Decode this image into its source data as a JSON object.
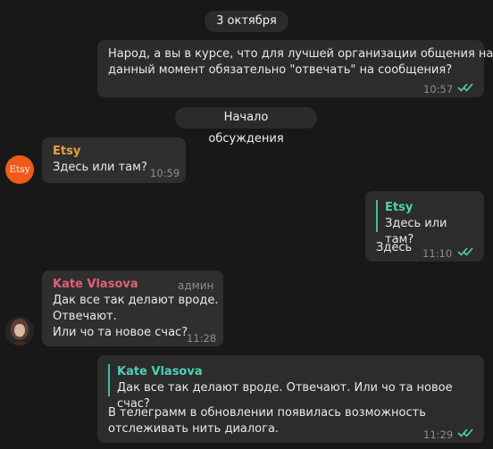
{
  "date_pill": "3 октября",
  "discussion_pill": "Начало обсуждения",
  "msg1": {
    "line1": "Народ, а вы в курсе, что для лучшей организации общения на",
    "line2": "данный момент обязательно \"отвечать\" на сообщения?",
    "time": "10:57"
  },
  "msg2": {
    "sender": "Etsy",
    "text": "Здесь или там?",
    "time": "10:59",
    "avatar_text": "Etsy",
    "sender_color": "#e7a13f",
    "avatar_color": "#ef5a1b"
  },
  "msg3": {
    "quote_name": "Etsy",
    "quote_text": "Здесь или там?",
    "text": "Здесь",
    "time": "11:10"
  },
  "msg4": {
    "sender": "Kate Vlasova",
    "role": "админ",
    "line1": "Дак все так делают вроде.",
    "line2": "Отвечают.",
    "line3": "Или чо та новое счас?",
    "time": "11:28",
    "sender_color": "#e0607a"
  },
  "msg5": {
    "quote_name": "Kate Vlasova",
    "quote_text": "Дак все так делают вроде. Отвечают. Или чо та новое счас?",
    "line1": "В телеграмм в обновлении появилась возможность",
    "line2": "отслеживать нить диалога.",
    "time": "11:29"
  },
  "colors": {
    "background": "#181818",
    "bubble": "#2f2f2f",
    "read_ticks": "#4fd1b4",
    "quote_accent": "#3fc0a6"
  }
}
